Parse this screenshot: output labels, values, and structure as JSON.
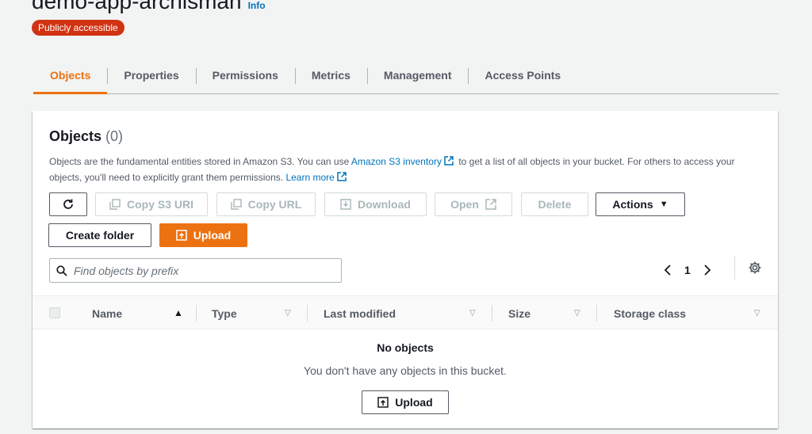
{
  "bucket": {
    "name": "demo-app-archisman",
    "info_label": "Info",
    "access_badge": "Publicly accessible"
  },
  "tabs": [
    {
      "label": "Objects",
      "active": true
    },
    {
      "label": "Properties",
      "active": false
    },
    {
      "label": "Permissions",
      "active": false
    },
    {
      "label": "Metrics",
      "active": false
    },
    {
      "label": "Management",
      "active": false
    },
    {
      "label": "Access Points",
      "active": false
    }
  ],
  "objects_panel": {
    "heading": "Objects",
    "count": "(0)",
    "desc_part1": "Objects are the fundamental entities stored in Amazon S3. You can use ",
    "inventory_link": "Amazon S3 inventory",
    "desc_part2": " to get a list of all objects in your bucket. For others to access your objects, you'll need to explicitly grant them permissions. ",
    "learn_more": "Learn more"
  },
  "toolbar": {
    "copy_s3_uri": "Copy S3 URI",
    "copy_url": "Copy URL",
    "download": "Download",
    "open": "Open",
    "delete": "Delete",
    "actions": "Actions",
    "create_folder": "Create folder",
    "upload": "Upload"
  },
  "search": {
    "placeholder": "Find objects by prefix"
  },
  "pagination": {
    "current_page": "1"
  },
  "table": {
    "columns": [
      "Name",
      "Type",
      "Last modified",
      "Size",
      "Storage class"
    ],
    "sort_column": "Name"
  },
  "empty_state": {
    "title": "No objects",
    "message": "You don't have any objects in this bucket.",
    "upload": "Upload"
  },
  "colors": {
    "accent": "#ec7211",
    "link": "#0073bb",
    "badge": "#d13212"
  }
}
